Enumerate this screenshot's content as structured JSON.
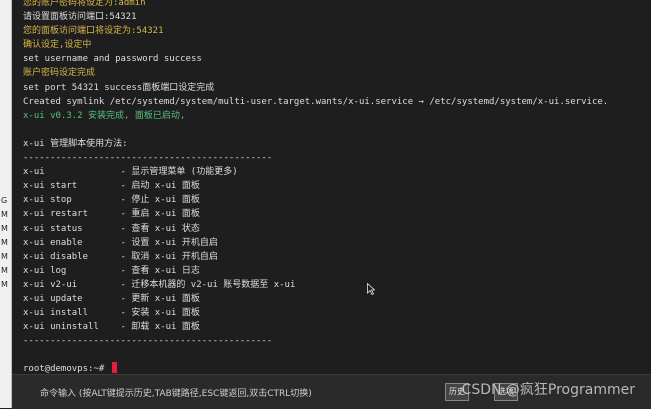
{
  "left_strip_letters": [
    "G",
    "M",
    "M",
    "M",
    "M",
    "M",
    "M"
  ],
  "terminal_lines": [
    {
      "text": "您的账户密码将设定为:admin",
      "cls": "c-yellow"
    },
    {
      "text": "请设置面板访问端口:54321",
      "cls": "c-white"
    },
    {
      "text": "您的面板访问端口将设定为:54321",
      "cls": "c-yellow"
    },
    {
      "text": "确认设定,设定中",
      "cls": "c-yellow"
    },
    {
      "text": "set username and password success",
      "cls": "c-white"
    },
    {
      "text": "账户密码设定完成",
      "cls": "c-yellow"
    },
    {
      "text": "set port 54321 success面板端口设定完成",
      "cls": "c-white"
    },
    {
      "text": "Created symlink /etc/systemd/system/multi-user.target.wants/x-ui.service → /etc/systemd/system/x-ui.service.",
      "cls": "c-white"
    },
    {
      "text": "x-ui v0.3.2 安装完成, 面板已启动,",
      "cls": "c-green"
    },
    {
      "text": "",
      "cls": "c-white"
    },
    {
      "text": "x-ui 管理脚本使用方法:",
      "cls": "c-white"
    },
    {
      "text": "----------------------------------------------",
      "cls": "c-white"
    },
    {
      "text": "x-ui              - 显示管理菜单 (功能更多)",
      "cls": "c-white"
    },
    {
      "text": "x-ui start        - 启动 x-ui 面板",
      "cls": "c-white"
    },
    {
      "text": "x-ui stop         - 停止 x-ui 面板",
      "cls": "c-white"
    },
    {
      "text": "x-ui restart      - 重启 x-ui 面板",
      "cls": "c-white"
    },
    {
      "text": "x-ui status       - 查看 x-ui 状态",
      "cls": "c-white"
    },
    {
      "text": "x-ui enable       - 设置 x-ui 开机自启",
      "cls": "c-white"
    },
    {
      "text": "x-ui disable      - 取消 x-ui 开机自启",
      "cls": "c-white"
    },
    {
      "text": "x-ui log          - 查看 x-ui 日志",
      "cls": "c-white"
    },
    {
      "text": "x-ui v2-ui        - 迁移本机器的 v2-ui 账号数据至 x-ui",
      "cls": "c-white"
    },
    {
      "text": "x-ui update       - 更新 x-ui 面板",
      "cls": "c-white"
    },
    {
      "text": "x-ui install      - 安装 x-ui 面板",
      "cls": "c-white"
    },
    {
      "text": "x-ui uninstall    - 卸载 x-ui 面板",
      "cls": "c-white"
    },
    {
      "text": "----------------------------------------------",
      "cls": "c-white"
    },
    {
      "text": "",
      "cls": "c-white"
    }
  ],
  "prompt": "root@demovps:~# ",
  "command_hint": "命令输入 (按ALT键提示历史,TAB键路径,ESC键返回,双击CTRL切换)",
  "buttons": {
    "history": "历史",
    "options": "选项"
  },
  "watermark": "CSDN @疯狂Programmer"
}
